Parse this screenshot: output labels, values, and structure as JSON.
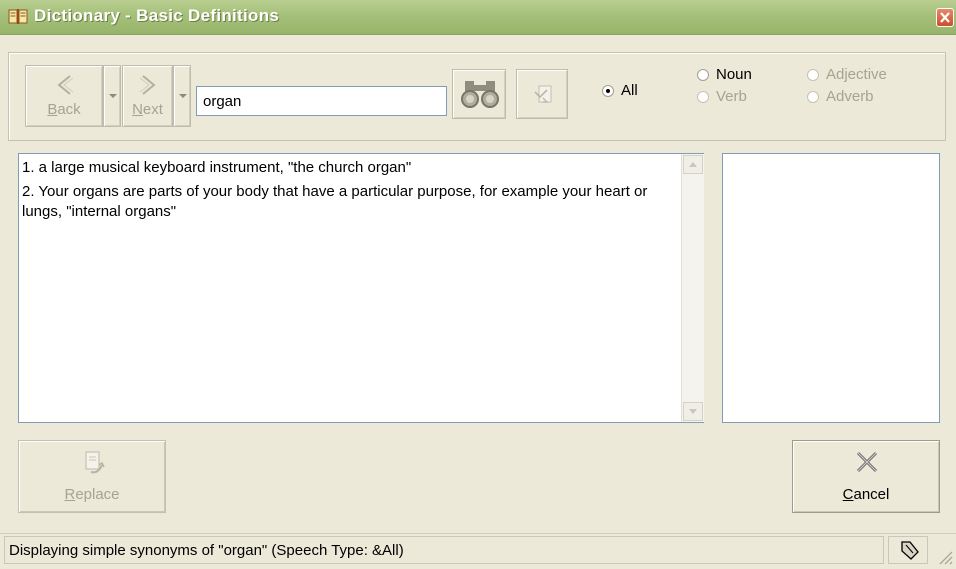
{
  "window": {
    "title": "Dictionary - Basic Definitions",
    "icons": [
      "book-icon",
      "close-icon"
    ]
  },
  "toolbar": {
    "back_label": "Back",
    "back_mnemonic": "B",
    "next_label": "Next",
    "next_mnemonic": "N",
    "search_value": "organ",
    "icons": [
      "back-arrow-icon",
      "next-arrow-icon",
      "binoculars-icon",
      "lookup-icon"
    ]
  },
  "speech_filter": {
    "selected": "All",
    "options": [
      {
        "label": "All",
        "selected": true,
        "enabled": true
      },
      {
        "label": "Noun",
        "selected": false,
        "enabled": true
      },
      {
        "label": "Verb",
        "selected": false,
        "enabled": false
      },
      {
        "label": "Adjective",
        "selected": false,
        "enabled": false
      },
      {
        "label": "Adverb",
        "selected": false,
        "enabled": false
      }
    ]
  },
  "definitions": [
    "1. a large musical keyboard instrument, \"the church organ\"",
    "2. Your organs are parts of your body that have a particular purpose, for example your heart or lungs, \"internal organs\""
  ],
  "synonyms": [],
  "buttons": {
    "replace_label": "Replace",
    "replace_enabled": false,
    "cancel_label": "Cancel",
    "icons": [
      "replace-icon",
      "cancel-x-icon"
    ]
  },
  "status": {
    "text": "Displaying simple synonyms of \"organ\" (Speech Type: &All)",
    "icons": [
      "pin-icon",
      "resize-grip-icon"
    ]
  },
  "colors": {
    "titlebar": "#a5c07a",
    "face": "#ece9d8",
    "disabled_text": "#a6a394",
    "field_border": "#7f9db9"
  }
}
